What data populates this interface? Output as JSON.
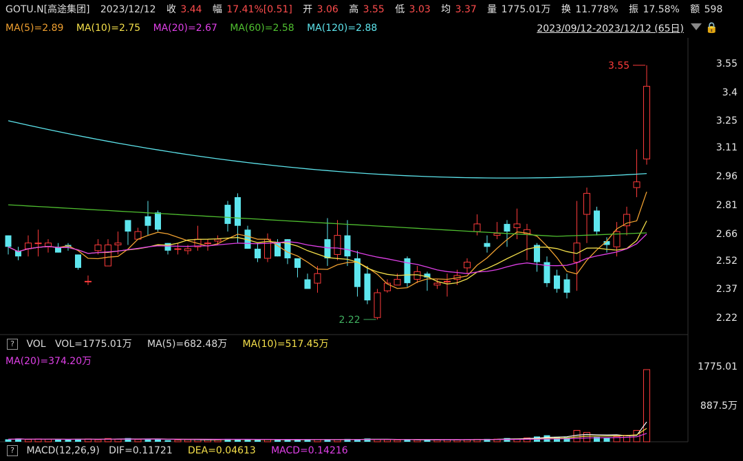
{
  "header": {
    "symbol": "GOTU.N[高途集团]",
    "date": "2023/12/12",
    "close_label": "收",
    "close": "3.44",
    "change_label": "幅",
    "change": "17.41%[0.51]",
    "open_label": "开",
    "open": "3.06",
    "high_label": "高",
    "high": "3.55",
    "low_label": "低",
    "low": "3.03",
    "avg_label": "均",
    "avg": "3.37",
    "vol_label": "量",
    "vol": "1775.01万",
    "turnover_label": "换",
    "turnover": "11.778%",
    "amp_label": "振",
    "amp": "17.58%",
    "amount_label": "额",
    "amount": "598"
  },
  "ma_legend": [
    {
      "text": "MA(5)=2.89",
      "color": "#f0a030"
    },
    {
      "text": "MA(10)=2.75",
      "color": "#f5e04a"
    },
    {
      "text": "MA(20)=2.67",
      "color": "#e040e8"
    },
    {
      "text": "MA(60)=2.58",
      "color": "#50c030"
    },
    {
      "text": "MA(120)=2.88",
      "color": "#5ee6ee"
    }
  ],
  "date_range": "2023/09/12-2023/12/12 (65日)",
  "price_axis": [
    "3.55",
    "3.4",
    "3.25",
    "3.11",
    "2.96",
    "2.81",
    "2.66",
    "2.52",
    "2.37",
    "2.22"
  ],
  "annotations": {
    "high_marker": "3.55",
    "low_marker": "2.22"
  },
  "volume": {
    "title": "VOL",
    "vol_text": "VOL=1775.01万",
    "ma5_text": "MA(5)=682.48万",
    "ma10_text": "MA(10)=517.45万",
    "ma20_text": "MA(20)=374.20万",
    "axis": [
      "1775.01",
      "887.5万"
    ]
  },
  "macd": {
    "title": "MACD(12,26,9)",
    "dif_text": "DIF=0.11721",
    "dea_text": "DEA=0.04613",
    "macd_text": "MACD=0.14216"
  },
  "colors": {
    "up": "#ff3b3b",
    "down": "#5ee6ee",
    "bg": "#000000"
  },
  "candles": [
    [
      2.66,
      2.6,
      2.66,
      2.56
    ],
    [
      2.58,
      2.55,
      2.6,
      2.53
    ],
    [
      2.59,
      2.62,
      2.66,
      2.55
    ],
    [
      2.62,
      2.62,
      2.69,
      2.55
    ],
    [
      2.6,
      2.62,
      2.64,
      2.57
    ],
    [
      2.6,
      2.57,
      2.62,
      2.57
    ],
    [
      2.61,
      2.6,
      2.62,
      2.58
    ],
    [
      2.56,
      2.49,
      2.56,
      2.48
    ],
    [
      2.42,
      2.42,
      2.45,
      2.4
    ],
    [
      2.58,
      2.61,
      2.64,
      2.56
    ],
    [
      2.5,
      2.61,
      2.64,
      2.5
    ],
    [
      2.61,
      2.62,
      2.68,
      2.56
    ],
    [
      2.74,
      2.68,
      2.74,
      2.61
    ],
    [
      2.64,
      2.68,
      2.7,
      2.64
    ],
    [
      2.76,
      2.71,
      2.84,
      2.66
    ],
    [
      2.78,
      2.69,
      2.79,
      2.68
    ],
    [
      2.62,
      2.58,
      2.62,
      2.56
    ],
    [
      2.59,
      2.59,
      2.62,
      2.56
    ],
    [
      2.58,
      2.59,
      2.61,
      2.56
    ],
    [
      2.6,
      2.64,
      2.71,
      2.58
    ],
    [
      2.62,
      2.62,
      2.64,
      2.58
    ],
    [
      2.63,
      2.64,
      2.66,
      2.61
    ],
    [
      2.82,
      2.72,
      2.84,
      2.68
    ],
    [
      2.86,
      2.71,
      2.88,
      2.62
    ],
    [
      2.69,
      2.59,
      2.71,
      2.59
    ],
    [
      2.59,
      2.54,
      2.62,
      2.52
    ],
    [
      2.54,
      2.64,
      2.67,
      2.52
    ],
    [
      2.62,
      2.55,
      2.64,
      2.55
    ],
    [
      2.64,
      2.54,
      2.64,
      2.51
    ],
    [
      2.54,
      2.49,
      2.54,
      2.44
    ],
    [
      2.43,
      2.38,
      2.46,
      2.41
    ],
    [
      2.41,
      2.46,
      2.5,
      2.36
    ],
    [
      2.64,
      2.54,
      2.75,
      2.5
    ],
    [
      2.56,
      2.66,
      2.74,
      2.53
    ],
    [
      2.66,
      2.55,
      2.74,
      2.5
    ],
    [
      2.54,
      2.39,
      2.58,
      2.34
    ],
    [
      2.46,
      2.32,
      2.5,
      2.3
    ],
    [
      2.23,
      2.36,
      2.38,
      2.22
    ],
    [
      2.37,
      2.41,
      2.43,
      2.36
    ],
    [
      2.4,
      2.43,
      2.46,
      2.4
    ],
    [
      2.54,
      2.41,
      2.55,
      2.39
    ],
    [
      2.43,
      2.47,
      2.5,
      2.41
    ],
    [
      2.46,
      2.44,
      2.47,
      2.37
    ],
    [
      2.4,
      2.41,
      2.43,
      2.38
    ],
    [
      2.42,
      2.42,
      2.46,
      2.34
    ],
    [
      2.43,
      2.45,
      2.48,
      2.4
    ],
    [
      2.49,
      2.52,
      2.54,
      2.46
    ],
    [
      2.68,
      2.72,
      2.77,
      2.66
    ],
    [
      2.62,
      2.6,
      2.66,
      2.57
    ],
    [
      2.66,
      2.67,
      2.73,
      2.64
    ],
    [
      2.72,
      2.68,
      2.74,
      2.6
    ],
    [
      2.7,
      2.72,
      2.8,
      2.64
    ],
    [
      2.67,
      2.69,
      2.72,
      2.53
    ],
    [
      2.61,
      2.52,
      2.62,
      2.47
    ],
    [
      2.52,
      2.41,
      2.55,
      2.39
    ],
    [
      2.45,
      2.38,
      2.48,
      2.36
    ],
    [
      2.43,
      2.36,
      2.46,
      2.33
    ],
    [
      2.52,
      2.62,
      2.84,
      2.37
    ],
    [
      2.77,
      2.88,
      2.91,
      2.62
    ],
    [
      2.79,
      2.68,
      2.81,
      2.66
    ],
    [
      2.63,
      2.61,
      2.65,
      2.57
    ],
    [
      2.6,
      2.68,
      2.73,
      2.55
    ],
    [
      2.71,
      2.77,
      2.81,
      2.66
    ],
    [
      2.91,
      2.94,
      3.11,
      2.86
    ],
    [
      3.06,
      3.44,
      3.55,
      3.03
    ]
  ],
  "vols": [
    60,
    80,
    55,
    70,
    60,
    55,
    50,
    75,
    70,
    50,
    80,
    60,
    90,
    55,
    70,
    75,
    40,
    45,
    50,
    55,
    55,
    45,
    70,
    60,
    55,
    45,
    50,
    45,
    55,
    50,
    60,
    55,
    45,
    50,
    70,
    60,
    80,
    55,
    50,
    45,
    50,
    45,
    50,
    45,
    55,
    45,
    55,
    60,
    70,
    65,
    90,
    70,
    95,
    130,
    160,
    120,
    110,
    280,
    230,
    120,
    95,
    130,
    160,
    280,
    1775
  ]
}
